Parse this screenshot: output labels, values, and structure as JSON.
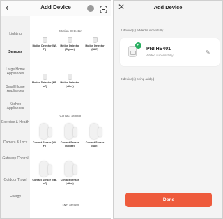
{
  "colors": {
    "accent": "#ee5b3c",
    "success_badge": "#27ae60",
    "sidebar_bg": "#f2f2f2",
    "content_bg": "#ffffff"
  },
  "left_screen": {
    "header": {
      "back_icon": "back-chevron-icon",
      "title": "Add Device",
      "menu_icon": "dot-icon",
      "scan_icon": "scan-icon"
    },
    "categories": [
      {
        "label": "Lighting",
        "active": false
      },
      {
        "label": "Sensors",
        "active": true
      },
      {
        "label": "Large Home Appliances",
        "active": false
      },
      {
        "label": "Small Home Appliances",
        "active": false
      },
      {
        "label": "Kitchen Appliances",
        "active": false
      },
      {
        "label": "Exercise & Health",
        "active": false
      },
      {
        "label": "Camera & Lock",
        "active": false
      },
      {
        "label": "Gateway Control",
        "active": false
      },
      {
        "label": "Outdoor Travel",
        "active": false
      },
      {
        "label": "Energy",
        "active": false
      }
    ],
    "sections": [
      {
        "title": "Motion Detector",
        "devices": [
          {
            "label": "Motion Detector (Wi-Fi)"
          },
          {
            "label": "Motion Detector (Zigbee)"
          },
          {
            "label": "Motion Detector (BLE)"
          },
          {
            "label": "Motion Detector (NB-IoT)"
          },
          {
            "label": "Motion Detector (other)"
          }
        ]
      },
      {
        "title": "Contact Sensor",
        "devices": [
          {
            "label": "Contact Sensor (Wi-Fi)"
          },
          {
            "label": "Contact Sensor (Zigbee)"
          },
          {
            "label": "Contact Sensor (BLE)"
          },
          {
            "label": "Contact Sensor (NB-IoT)"
          },
          {
            "label": "Contact Sensor (other)"
          }
        ]
      },
      {
        "title": "T&H Sensor",
        "devices": []
      }
    ]
  },
  "right_screen": {
    "close_icon": "close-icon",
    "title": "Add Device",
    "added_summary": "1 device(s) added successfully",
    "device": {
      "name": "PNI HS401",
      "status": "Added successfully",
      "edit_icon": "pencil-edit-icon"
    },
    "adding_summary": "0 device(s) being added",
    "done_label": "Done"
  }
}
